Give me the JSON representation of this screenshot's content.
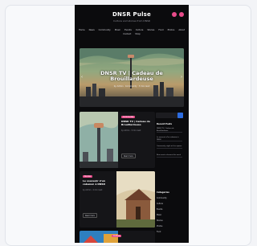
{
  "site": {
    "brand": "DNSR Pulse",
    "tagline": "Culture and stories from DNSR",
    "nav": [
      "Home",
      "News",
      "Community",
      "Music",
      "Events",
      "Culture",
      "Stories",
      "Food",
      "Photos",
      "About",
      "Contact",
      "Shop"
    ]
  },
  "hero": {
    "title": "DNSR TV | Cadeau de Brouillardeuse",
    "meta": "by Admin · Community · 3 min read"
  },
  "posts": [
    {
      "tag": "Community",
      "title": "DNSR TV | Cadeau de Brouillardeuse",
      "meta": "by Admin · 3 min read",
      "button": "Read more"
    },
    {
      "tag": "Stories",
      "title": "Le souvenir d'un cabanon à DNSR",
      "meta": "by Admin · 4 min read",
      "button": "Read more"
    },
    {
      "tag": "Culture"
    }
  ],
  "sidebar": {
    "recent_title": "Recent Posts",
    "recent": [
      "DNSR TV | Cadeau de Brouillardeuse",
      "Le souvenir d'un cabanon à DNSR",
      "Community night at the square",
      "New music releases this week"
    ],
    "categories_title": "Categories",
    "categories": [
      "Community",
      "Culture",
      "Events",
      "Music",
      "Stories",
      "Photos",
      "Food"
    ]
  },
  "colors": {
    "accent": "#e84b8a",
    "background": "#0b0b0d",
    "search_button": "#2d6cdf"
  }
}
